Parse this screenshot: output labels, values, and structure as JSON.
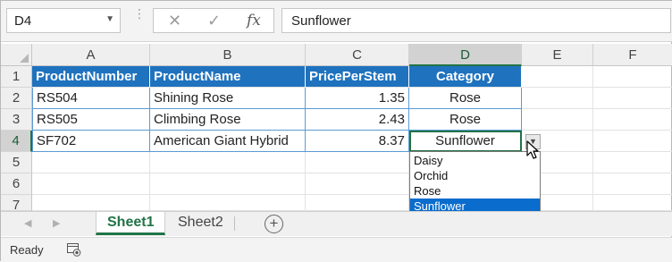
{
  "formula_bar": {
    "name_box": "D4",
    "formula_value": "Sunflower",
    "cancel_glyph": "✕",
    "enter_glyph": "✓",
    "fx_glyph": "fx"
  },
  "columns": [
    "A",
    "B",
    "C",
    "D",
    "E",
    "F"
  ],
  "rows": [
    "1",
    "2",
    "3",
    "4",
    "5",
    "6",
    "7"
  ],
  "table": {
    "headers": [
      "ProductNumber",
      "ProductName",
      "PricePerStem",
      "Category"
    ],
    "rows": [
      [
        "RS504",
        "Shining Rose",
        "1.35",
        "Rose"
      ],
      [
        "RS505",
        "Climbing Rose",
        "2.43",
        "Rose"
      ],
      [
        "SF702",
        "American Giant Hybrid",
        "8.37",
        "Sunflower"
      ]
    ]
  },
  "dropdown": {
    "options": [
      "Daisy",
      "Orchid",
      "Rose",
      "Sunflower"
    ],
    "selected": "Sunflower"
  },
  "sheets": {
    "tabs": [
      "Sheet1",
      "Sheet2"
    ],
    "active": "Sheet1",
    "add_label": "+"
  },
  "status": {
    "text": "Ready"
  },
  "colors": {
    "header_fill": "#1f72be",
    "accent": "#217346",
    "list_selected": "#0a6ccc"
  },
  "icons": [
    "chevron-down-icon",
    "cancel-icon",
    "enter-icon",
    "function-icon",
    "prev-sheet-icon",
    "next-sheet-icon",
    "add-sheet-icon",
    "macro-recording-icon",
    "mouse-pointer-icon"
  ]
}
